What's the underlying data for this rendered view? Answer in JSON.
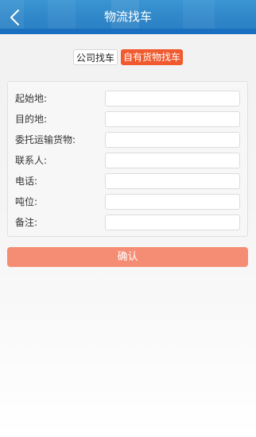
{
  "header": {
    "title": "物流找车",
    "back_icon": "chevron-left-icon",
    "background": "#2f86c8",
    "accent_strip": "#1b6fc0"
  },
  "tabs": [
    {
      "label": "公司找车",
      "active": false
    },
    {
      "label": "自有货物找车",
      "active": true
    }
  ],
  "form": {
    "fields": [
      {
        "label": "起始地:",
        "value": ""
      },
      {
        "label": "目的地:",
        "value": ""
      },
      {
        "label": "委托运输货物:",
        "value": ""
      },
      {
        "label": "联系人:",
        "value": ""
      },
      {
        "label": "电话:",
        "value": ""
      },
      {
        "label": "吨位:",
        "value": ""
      },
      {
        "label": "备注:",
        "value": ""
      }
    ]
  },
  "confirm_label": "确认",
  "colors": {
    "active_tab": "#f05a2e",
    "confirm_button": "#f58d74"
  }
}
